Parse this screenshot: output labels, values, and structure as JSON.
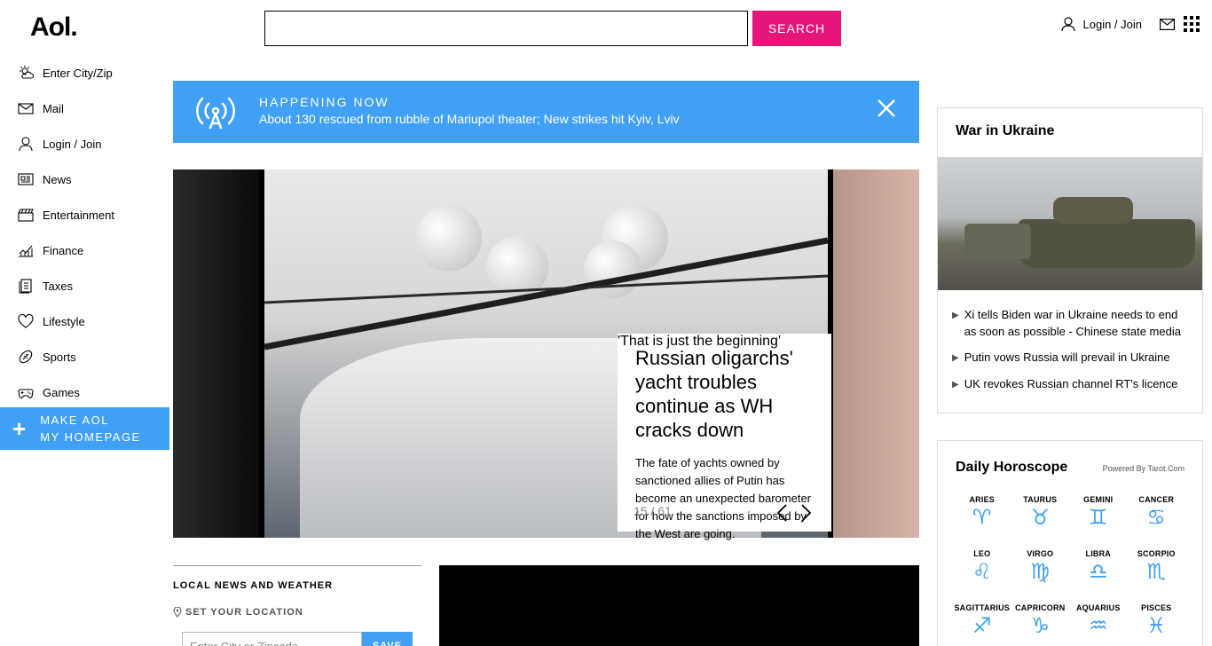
{
  "header": {
    "logo": "Aol.",
    "search_button": "SEARCH",
    "login": "Login / Join"
  },
  "sidebar": {
    "items": [
      {
        "label": "Enter City/Zip",
        "icon": "weather-icon"
      },
      {
        "label": "Mail",
        "icon": "mail-icon"
      },
      {
        "label": "Login / Join",
        "icon": "user-icon"
      },
      {
        "label": "News",
        "icon": "news-icon"
      },
      {
        "label": "Entertainment",
        "icon": "clapper-icon"
      },
      {
        "label": "Finance",
        "icon": "finance-icon"
      },
      {
        "label": "Taxes",
        "icon": "taxes-icon"
      },
      {
        "label": "Lifestyle",
        "icon": "heart-icon"
      },
      {
        "label": "Sports",
        "icon": "football-icon"
      },
      {
        "label": "Games",
        "icon": "gamepad-icon"
      }
    ],
    "make_homepage_line1": "MAKE AOL",
    "make_homepage_line2": "MY HOMEPAGE"
  },
  "happening": {
    "label": "HAPPENING NOW",
    "headline": "About 130 rescued from rubble of Mariupol theater; New strikes hit Kyiv, Lviv"
  },
  "carousel": {
    "title": "Russian oligarchs' yacht troubles continue as WH cracks down",
    "summary": "The fate of yachts owned by sanctioned allies of Putin has become an unexpected barometer for how the sanctions imposed by the West are going.",
    "quote": "'That is just the beginning'",
    "counter": "15 / 61"
  },
  "local": {
    "title": "LOCAL NEWS AND WEATHER",
    "set_location": "SET YOUR LOCATION",
    "placeholder": "Enter City or Zipcode",
    "save": "SAVE"
  },
  "ukraine": {
    "title": "War in Ukraine",
    "links": [
      "Xi tells Biden war in Ukraine needs to end as soon as possible - Chinese state media",
      "Putin vows Russia will prevail in Ukraine",
      "UK revokes Russian channel RT's licence"
    ]
  },
  "horoscope": {
    "title": "Daily Horoscope",
    "powered": "Powered By Tarot.Com",
    "signs": [
      {
        "name": "ARIES",
        "glyph": "♈"
      },
      {
        "name": "TAURUS",
        "glyph": "♉"
      },
      {
        "name": "GEMINI",
        "glyph": "♊"
      },
      {
        "name": "CANCER",
        "glyph": "♋"
      },
      {
        "name": "LEO",
        "glyph": "♌"
      },
      {
        "name": "VIRGO",
        "glyph": "♍"
      },
      {
        "name": "LIBRA",
        "glyph": "♎"
      },
      {
        "name": "SCORPIO",
        "glyph": "♏"
      },
      {
        "name": "SAGITTARIUS",
        "glyph": "♐"
      },
      {
        "name": "CAPRICORN",
        "glyph": "♑"
      },
      {
        "name": "AQUARIUS",
        "glyph": "♒"
      },
      {
        "name": "PISCES",
        "glyph": "♓"
      }
    ]
  },
  "colors": {
    "accent_blue": "#3fa0f5",
    "search_pink": "#e5157a"
  }
}
